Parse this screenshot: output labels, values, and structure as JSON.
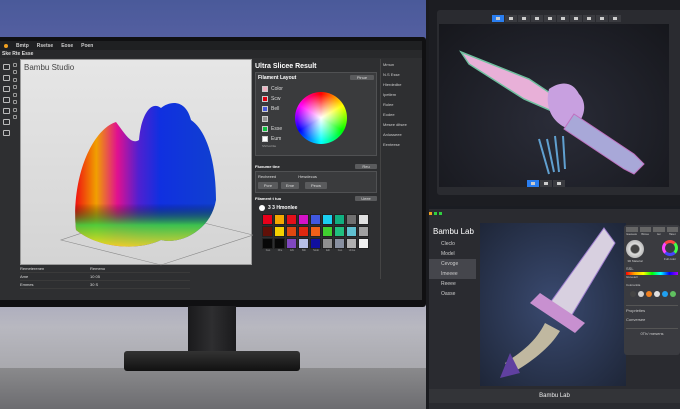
{
  "monitor": {
    "menu": [
      "Bmtp",
      "Rsetse",
      "Eose",
      "Poen"
    ],
    "toolbar_label": "Ske Rte Esse",
    "viewport_title": "Bambu Studio",
    "panel": {
      "title": "Ultra Slicee Result",
      "filament_layout": {
        "heading": "Filament Layout",
        "button": "Pinue",
        "swatches": [
          {
            "label": "Color",
            "color": "#f0b0c0"
          },
          {
            "label": "Scw",
            "color": "#e00010"
          },
          {
            "label": "Bell",
            "color": "#4858d8"
          },
          {
            "label": "",
            "color": "#909090"
          },
          {
            "label": "Esse",
            "color": "#10c040"
          },
          {
            "label": "Eum",
            "color": "#ffffff"
          }
        ],
        "footer": "SSVvolrtte"
      },
      "flux": {
        "heading": "Fluxume tine",
        "button": "Reu",
        "col1": "Recheeed",
        "col2": "Hewdecus",
        "buttons": [
          "Pcre",
          "Eme",
          "Peuw"
        ]
      },
      "filament_tuo": {
        "heading": "Filament t tuo",
        "button": "Ueee",
        "radio_label": "3 3 Hmonlee",
        "colors": [
          "#e8001a",
          "#f5a800",
          "#e5101a",
          "#d412c8",
          "#4058e0",
          "#1ad0f0",
          "#10b080",
          "#707070",
          "#e0e0e0",
          "#601008",
          "#f5d000",
          "#e04810",
          "#e02810",
          "#f06018",
          "#40d030",
          "#20c080",
          "#60c0d0",
          "#a0a0a0",
          "#080808",
          "#080808",
          "#8048c0",
          "#b8c0e8",
          "#1010a0",
          "#909090",
          "#8890a0",
          "#b0b0b0",
          "#f0f0f0"
        ],
        "color_labels": [
          "Ces",
          "Che",
          "Ehi",
          "Bdt",
          "Sodo",
          "Edt",
          "Ces",
          "Untse"
        ]
      }
    },
    "far_panel": [
      "Mmun",
      "N.S Esse",
      "Hierdedbe",
      "Ipetlem",
      "Rolee",
      "Eodee",
      "Mesee ditsee",
      "Anlusseee",
      "Eenteese"
    ],
    "bottom_table": {
      "headers": [
        "Remeterenen",
        "Remeno"
      ],
      "rows": [
        [
          "Ame",
          "10 05"
        ],
        [
          "Emmes",
          "30 S"
        ]
      ]
    }
  },
  "bottom_right": {
    "brand": "Bambu Lab",
    "nav": [
      "Cleclo",
      "Model",
      "Cevoge",
      "Imeeee",
      "Reeee",
      "Oasse"
    ],
    "props": {
      "tabs": [
        "Eaeseeie",
        "Blocee",
        "Aei",
        "Haset"
      ],
      "material": "3D Material",
      "full_color": "Full color",
      "ssl": "SSL",
      "gradient": "Gloveiell",
      "colorants": "Colorantila",
      "dots": [
        "#444444",
        "#d0d0d0",
        "#f08020",
        "#e0e0e0",
        "#20a0f0",
        "#60c060"
      ],
      "properties": "Proprieties",
      "conversion": "Conversee",
      "footer": "0Th/ mesens"
    },
    "caption": "Bambu Lab"
  }
}
